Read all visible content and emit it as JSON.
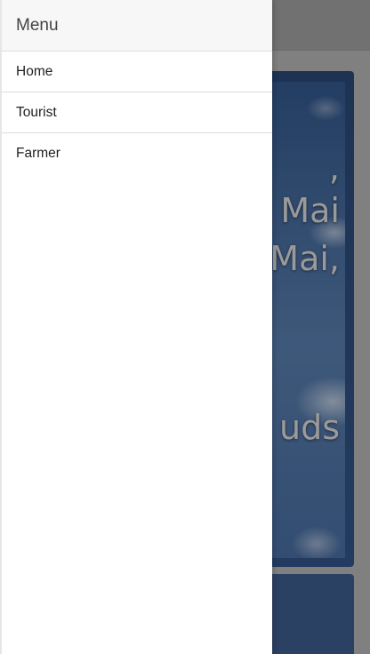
{
  "drawer": {
    "title": "Menu",
    "items": [
      {
        "label": "Home"
      },
      {
        "label": "Tourist"
      },
      {
        "label": "Farmer"
      }
    ]
  },
  "background": {
    "hero_lines": [
      ",",
      "Mai",
      "Mai,",
      "uds"
    ]
  },
  "colors": {
    "drawer_bg": "#ffffff",
    "header_bg": "#f7f7f7",
    "hero_blue": "#2c4a78"
  }
}
